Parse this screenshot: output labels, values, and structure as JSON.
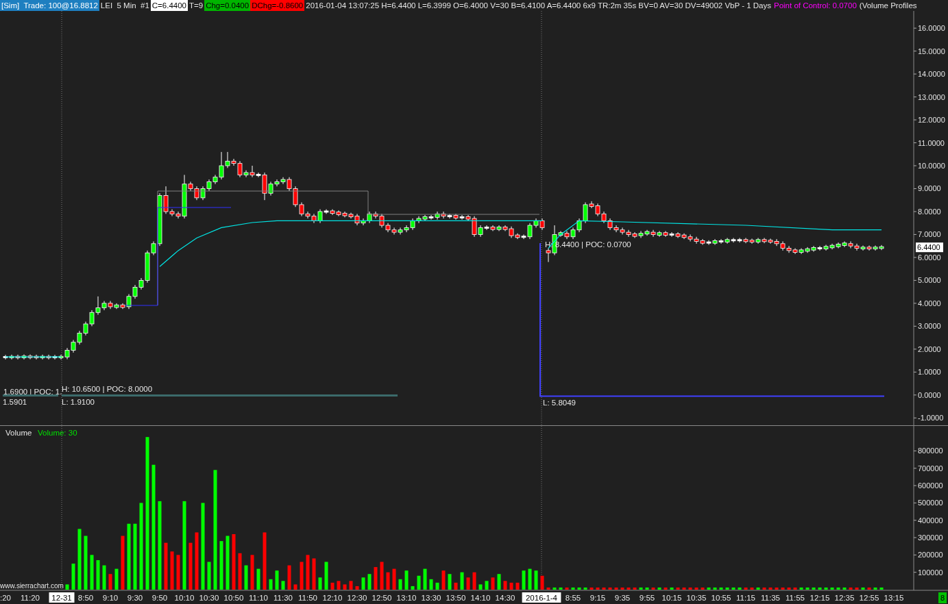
{
  "header": [
    {
      "text": "[Sim]  Trade: 100@16.8812",
      "kind": "sim"
    },
    {
      "text": "LEI  5 Min  #1",
      "kind": "plain"
    },
    {
      "text": "C=6.4400",
      "kind": "last"
    },
    {
      "text": "T=9",
      "kind": "plain"
    },
    {
      "text": "Chg=0.0400",
      "kind": "up"
    },
    {
      "text": "DChg=-0.8600",
      "kind": "down"
    },
    {
      "text": "2016-01-04 13:07:25 H=6.4400 L=6.3999 O=6.4000 V=30 B=6.4100 A=6.4400 6x9 TR:2m 35s BV=0 AV=30 DV=49002 VbP - 1 Days",
      "kind": "plain"
    },
    {
      "text": "Point of Control: 0.0700",
      "kind": "poc"
    },
    {
      "text": "(Volume Profiles",
      "kind": "plain"
    }
  ],
  "price_pane": {
    "labels": [
      "1.6900 | POC: 1.",
      "1.5901",
      "H: 10.6500 | POC: 8.0000",
      "L: 1.9100",
      "H: 8.4400 | POC: 0.0700",
      "L: 5.8049"
    ],
    "last_price": "6.4400",
    "chart_data": {
      "type": "candlestick",
      "ylim": [
        -1.35,
        16.75
      ],
      "categories": [
        null,
        null,
        null,
        null,
        null,
        null,
        null,
        null,
        null,
        null,
        null,
        null,
        null,
        null,
        null,
        null,
        null,
        null,
        null,
        null,
        null,
        null,
        null,
        null,
        null,
        null,
        null,
        null,
        null,
        null,
        null,
        null,
        null,
        null,
        null,
        null,
        null,
        null,
        null,
        null,
        null,
        null,
        null,
        null,
        null,
        null,
        null,
        null,
        null,
        null,
        null,
        null,
        null,
        null,
        null,
        null,
        null,
        null,
        null,
        null,
        null,
        null,
        null,
        null,
        null,
        null,
        null,
        null,
        null,
        null,
        null,
        null,
        null,
        null,
        null,
        null,
        null,
        null,
        null,
        null,
        null,
        null,
        null,
        null,
        null,
        null,
        null,
        null,
        null,
        null,
        null,
        null,
        null,
        null,
        null,
        null,
        null,
        null,
        null,
        null,
        null,
        null,
        null,
        null,
        null,
        null,
        null,
        null,
        null,
        null,
        null,
        null,
        null,
        null,
        null,
        null,
        null,
        null,
        null,
        null,
        null,
        null,
        null,
        null,
        null,
        null,
        null,
        null,
        null,
        null,
        null,
        null,
        null,
        null,
        null,
        null,
        null,
        null,
        null,
        null,
        null,
        null,
        null,
        null,
        null
      ],
      "yticks": [
        {
          "value": 16,
          "label": "16.0000"
        },
        {
          "value": 15,
          "label": "15.0000"
        },
        {
          "value": 14,
          "label": "14.0000"
        },
        {
          "value": 13,
          "label": "13.0000"
        },
        {
          "value": 12,
          "label": "12.0000"
        },
        {
          "value": 11,
          "label": "11.0000"
        },
        {
          "value": 10,
          "label": "10.0000"
        },
        {
          "value": 9,
          "label": "9.0000"
        },
        {
          "value": 8,
          "label": "8.0000"
        },
        {
          "value": 7,
          "label": "7.0000"
        },
        {
          "value": 6,
          "label": "6.0000"
        },
        {
          "value": 5,
          "label": "5.0000"
        },
        {
          "value": 4,
          "label": "4.0000"
        },
        {
          "value": 3,
          "label": "3.0000"
        },
        {
          "value": 2,
          "label": "2.0000"
        },
        {
          "value": 1,
          "label": "1.0000"
        },
        {
          "value": 0,
          "label": "0.0000"
        },
        {
          "value": -1,
          "label": "-1.0000"
        }
      ],
      "ohlc": [
        [
          1.65,
          1.75,
          1.55,
          1.65
        ],
        [
          1.65,
          1.76,
          1.55,
          1.66
        ],
        [
          1.66,
          1.76,
          1.55,
          1.65
        ],
        [
          1.65,
          1.77,
          1.55,
          1.67
        ],
        [
          1.67,
          1.77,
          1.56,
          1.66
        ],
        [
          1.66,
          1.76,
          1.55,
          1.65
        ],
        [
          1.65,
          1.76,
          1.55,
          1.66
        ],
        [
          1.66,
          1.76,
          1.55,
          1.65
        ],
        [
          1.65,
          1.75,
          1.55,
          1.65
        ],
        [
          1.65,
          1.76,
          1.55,
          1.66
        ],
        [
          1.66,
          2.05,
          1.56,
          1.95
        ],
        [
          1.95,
          2.4,
          1.85,
          2.3
        ],
        [
          2.3,
          2.8,
          2.2,
          2.7
        ],
        [
          2.7,
          3.2,
          2.6,
          3.1
        ],
        [
          3.1,
          3.7,
          3.0,
          3.6
        ],
        [
          3.6,
          4.3,
          3.5,
          3.8
        ],
        [
          3.8,
          4.1,
          3.7,
          4.0
        ],
        [
          4.0,
          4.1,
          3.75,
          3.85
        ],
        [
          3.85,
          4.0,
          3.75,
          3.9
        ],
        [
          3.9,
          4.0,
          3.75,
          3.85
        ],
        [
          3.85,
          4.4,
          3.75,
          4.3
        ],
        [
          4.3,
          4.8,
          4.2,
          4.7
        ],
        [
          4.7,
          5.1,
          4.6,
          5.0
        ],
        [
          5.0,
          6.3,
          4.9,
          6.2
        ],
        [
          6.2,
          6.7,
          6.1,
          6.6
        ],
        [
          6.6,
          8.8,
          6.5,
          8.7
        ],
        [
          8.7,
          9.1,
          7.9,
          8.0
        ],
        [
          8.0,
          8.1,
          7.8,
          7.9
        ],
        [
          7.9,
          8.0,
          7.7,
          7.8
        ],
        [
          7.8,
          9.6,
          7.7,
          9.2
        ],
        [
          9.2,
          9.3,
          8.9,
          9.0
        ],
        [
          9.0,
          9.1,
          8.5,
          8.6
        ],
        [
          8.6,
          9.1,
          8.5,
          9.0
        ],
        [
          9.0,
          9.4,
          8.9,
          9.3
        ],
        [
          9.3,
          9.6,
          9.2,
          9.5
        ],
        [
          9.5,
          10.6,
          9.4,
          10.0
        ],
        [
          10.0,
          10.6,
          9.9,
          10.2
        ],
        [
          10.2,
          10.3,
          10.0,
          10.1
        ],
        [
          10.1,
          10.2,
          9.5,
          9.6
        ],
        [
          9.6,
          9.8,
          9.5,
          9.7
        ],
        [
          9.7,
          10.0,
          9.5,
          9.6
        ],
        [
          9.6,
          9.7,
          9.5,
          9.6
        ],
        [
          9.6,
          9.7,
          8.5,
          8.8
        ],
        [
          8.8,
          9.3,
          8.7,
          9.2
        ],
        [
          9.2,
          9.4,
          9.1,
          9.3
        ],
        [
          9.3,
          9.5,
          9.2,
          9.4
        ],
        [
          9.4,
          9.5,
          8.9,
          9.0
        ],
        [
          9.0,
          9.1,
          8.2,
          8.3
        ],
        [
          8.3,
          8.4,
          7.8,
          7.9
        ],
        [
          7.9,
          8.0,
          7.7,
          7.8
        ],
        [
          7.8,
          7.9,
          7.5,
          7.6
        ],
        [
          7.6,
          8.1,
          7.5,
          8.0
        ],
        [
          8.0,
          8.1,
          7.9,
          8.0
        ],
        [
          8.0,
          8.1,
          7.85,
          7.95
        ],
        [
          7.95,
          8.05,
          7.8,
          7.9
        ],
        [
          7.9,
          8.0,
          7.75,
          7.85
        ],
        [
          7.85,
          7.95,
          7.7,
          7.8
        ],
        [
          7.8,
          7.9,
          7.4,
          7.5
        ],
        [
          7.5,
          7.7,
          7.4,
          7.6
        ],
        [
          7.6,
          8.0,
          7.5,
          7.9
        ],
        [
          7.9,
          8.0,
          7.7,
          7.8
        ],
        [
          7.8,
          7.9,
          7.3,
          7.4
        ],
        [
          7.4,
          7.5,
          7.1,
          7.2
        ],
        [
          7.2,
          7.3,
          7.0,
          7.1
        ],
        [
          7.1,
          7.3,
          7.0,
          7.2
        ],
        [
          7.2,
          7.4,
          7.1,
          7.3
        ],
        [
          7.3,
          7.7,
          7.2,
          7.6
        ],
        [
          7.6,
          7.8,
          7.5,
          7.7
        ],
        [
          7.7,
          7.85,
          7.6,
          7.75
        ],
        [
          7.75,
          7.85,
          7.65,
          7.75
        ],
        [
          7.75,
          8.0,
          7.65,
          7.9
        ],
        [
          7.9,
          8.0,
          7.7,
          7.8
        ],
        [
          7.8,
          7.9,
          7.7,
          7.8
        ],
        [
          7.8,
          7.9,
          7.65,
          7.75
        ],
        [
          7.75,
          7.85,
          7.65,
          7.75
        ],
        [
          7.75,
          7.85,
          7.6,
          7.7
        ],
        [
          7.7,
          7.8,
          6.9,
          7.0
        ],
        [
          7.0,
          7.4,
          6.9,
          7.3
        ],
        [
          7.3,
          7.4,
          7.2,
          7.3
        ],
        [
          7.3,
          7.4,
          7.15,
          7.25
        ],
        [
          7.25,
          7.4,
          7.15,
          7.3
        ],
        [
          7.3,
          7.4,
          7.15,
          7.25
        ],
        [
          7.25,
          7.35,
          6.85,
          6.95
        ],
        [
          6.95,
          7.05,
          6.8,
          6.9
        ],
        [
          6.9,
          7.0,
          6.8,
          6.9
        ],
        [
          6.9,
          7.5,
          6.8,
          7.4
        ],
        [
          7.4,
          7.7,
          7.3,
          7.6
        ],
        [
          7.6,
          7.7,
          7.2,
          7.3
        ],
        [
          6.3,
          6.4,
          5.8,
          6.2
        ],
        [
          6.2,
          7.4,
          6.1,
          7.0
        ],
        [
          7.0,
          7.15,
          6.9,
          7.05
        ],
        [
          7.05,
          7.15,
          6.8,
          6.9
        ],
        [
          6.9,
          7.3,
          6.8,
          7.2
        ],
        [
          7.2,
          7.7,
          7.1,
          7.6
        ],
        [
          7.6,
          8.4,
          7.5,
          8.3
        ],
        [
          8.3,
          8.45,
          8.15,
          8.25
        ],
        [
          8.25,
          8.35,
          7.8,
          7.9
        ],
        [
          7.9,
          8.0,
          7.5,
          7.6
        ],
        [
          7.6,
          7.7,
          7.2,
          7.3
        ],
        [
          7.3,
          7.4,
          7.1,
          7.2
        ],
        [
          7.2,
          7.3,
          7.0,
          7.1
        ],
        [
          7.1,
          7.2,
          6.9,
          7.0
        ],
        [
          7.0,
          7.1,
          6.85,
          6.95
        ],
        [
          6.95,
          7.15,
          6.85,
          7.05
        ],
        [
          7.05,
          7.2,
          6.95,
          7.1
        ],
        [
          7.1,
          7.2,
          6.9,
          7.0
        ],
        [
          7.0,
          7.15,
          6.9,
          7.05
        ],
        [
          7.05,
          7.15,
          6.9,
          7.0
        ],
        [
          7.0,
          7.1,
          6.9,
          7.0
        ],
        [
          7.0,
          7.1,
          6.85,
          6.95
        ],
        [
          6.95,
          7.05,
          6.8,
          6.9
        ],
        [
          6.9,
          7.0,
          6.7,
          6.8
        ],
        [
          6.8,
          6.9,
          6.6,
          6.7
        ],
        [
          6.7,
          6.8,
          6.55,
          6.65
        ],
        [
          6.65,
          6.75,
          6.55,
          6.65
        ],
        [
          6.65,
          6.8,
          6.55,
          6.7
        ],
        [
          6.7,
          6.8,
          6.6,
          6.7
        ],
        [
          6.7,
          6.85,
          6.6,
          6.75
        ],
        [
          6.75,
          6.85,
          6.65,
          6.75
        ],
        [
          6.75,
          6.85,
          6.65,
          6.75
        ],
        [
          6.75,
          6.85,
          6.62,
          6.72
        ],
        [
          6.72,
          6.82,
          6.6,
          6.7
        ],
        [
          6.7,
          6.85,
          6.6,
          6.75
        ],
        [
          6.75,
          6.85,
          6.62,
          6.72
        ],
        [
          6.72,
          6.82,
          6.6,
          6.7
        ],
        [
          6.7,
          6.8,
          6.5,
          6.6
        ],
        [
          6.6,
          6.7,
          6.3,
          6.4
        ],
        [
          6.4,
          6.5,
          6.2,
          6.3
        ],
        [
          6.3,
          6.4,
          6.15,
          6.25
        ],
        [
          6.25,
          6.4,
          6.15,
          6.3
        ],
        [
          6.3,
          6.45,
          6.2,
          6.35
        ],
        [
          6.35,
          6.5,
          6.25,
          6.4
        ],
        [
          6.4,
          6.5,
          6.3,
          6.4
        ],
        [
          6.4,
          6.55,
          6.3,
          6.45
        ],
        [
          6.45,
          6.6,
          6.35,
          6.5
        ],
        [
          6.5,
          6.65,
          6.4,
          6.55
        ],
        [
          6.55,
          6.7,
          6.45,
          6.6
        ],
        [
          6.6,
          6.7,
          6.4,
          6.5
        ],
        [
          6.5,
          6.6,
          6.3,
          6.4
        ],
        [
          6.4,
          6.52,
          6.3,
          6.42
        ],
        [
          6.42,
          6.52,
          6.3,
          6.4
        ],
        [
          6.4,
          6.52,
          6.3,
          6.42
        ],
        [
          6.42,
          6.54,
          6.32,
          6.44
        ],
        null,
        null
      ]
    }
  },
  "volume_pane": {
    "reading": "Volume: 30",
    "watermark": "www.sierrachart.com",
    "session_dates": [
      "12-31",
      "2016-1-4"
    ],
    "chart_data": {
      "type": "bar",
      "title": "Volume",
      "ylim": [
        0,
        944000
      ],
      "categories": [
        ":20",
        null,
        null,
        null,
        "11:20",
        null,
        null,
        null,
        null,
        null,
        null,
        null,
        null,
        "8:50",
        null,
        null,
        null,
        "9:10",
        null,
        null,
        null,
        "9:30",
        null,
        null,
        null,
        "9:50",
        null,
        null,
        null,
        "10:10",
        null,
        null,
        null,
        "10:30",
        null,
        null,
        null,
        "10:50",
        null,
        null,
        null,
        "11:10",
        null,
        null,
        null,
        "11:30",
        null,
        null,
        null,
        "11:50",
        null,
        null,
        null,
        "12:10",
        null,
        null,
        null,
        "12:30",
        null,
        null,
        null,
        "12:50",
        null,
        null,
        null,
        "13:10",
        null,
        null,
        null,
        "13:30",
        null,
        null,
        null,
        "13:50",
        null,
        null,
        null,
        "14:10",
        null,
        null,
        null,
        "14:30",
        null,
        null,
        null,
        null,
        null,
        null,
        null,
        null,
        null,
        null,
        "8:55",
        null,
        null,
        null,
        "9:15",
        null,
        null,
        null,
        "9:35",
        null,
        null,
        null,
        "9:55",
        null,
        null,
        null,
        "10:15",
        null,
        null,
        null,
        "10:35",
        null,
        null,
        null,
        "10:55",
        null,
        null,
        null,
        "11:15",
        null,
        null,
        null,
        "11:35",
        null,
        null,
        null,
        "11:55",
        null,
        null,
        null,
        "12:15",
        null,
        null,
        null,
        "12:35",
        null,
        null,
        null,
        "12:55",
        null,
        null,
        null,
        "13:15"
      ],
      "yticks": [
        {
          "value": 800000,
          "label": "800000"
        },
        {
          "value": 700000,
          "label": "700000"
        },
        {
          "value": 600000,
          "label": "600000"
        },
        {
          "value": 500000,
          "label": "500000"
        },
        {
          "value": 400000,
          "label": "400000"
        },
        {
          "value": 300000,
          "label": "300000"
        },
        {
          "value": 200000,
          "label": "200000"
        },
        {
          "value": 100000,
          "label": "100000"
        }
      ],
      "series": [
        {
          "color": "#00ff00",
          "values": [
            null,
            null,
            null,
            null,
            null,
            null,
            null,
            null,
            null,
            null,
            30000,
            150000,
            350000,
            310000,
            200000,
            170000,
            140000,
            null,
            120000,
            null,
            380000,
            380000,
            500000,
            880000,
            720000,
            510000,
            null,
            null,
            null,
            510000,
            null,
            null,
            500000,
            160000,
            690000,
            280000,
            310000,
            null,
            null,
            140000,
            null,
            120000,
            null,
            60000,
            110000,
            50000,
            null,
            null,
            null,
            null,
            null,
            70000,
            160000,
            null,
            null,
            null,
            null,
            null,
            70000,
            90000,
            null,
            null,
            null,
            null,
            60000,
            110000,
            20000,
            80000,
            120000,
            60000,
            40000,
            null,
            90000,
            null,
            100000,
            null,
            null,
            30000,
            50000,
            null,
            90000,
            null,
            null,
            null,
            110000,
            120000,
            110000,
            null,
            null,
            12000,
            12000,
            null,
            12000,
            12000,
            12000,
            null,
            null,
            null,
            null,
            null,
            null,
            null,
            null,
            12000,
            12000,
            null,
            12000,
            null,
            12000,
            null,
            null,
            null,
            null,
            null,
            12000,
            12000,
            12000,
            12000,
            12000,
            12000,
            null,
            null,
            12000,
            null,
            null,
            null,
            null,
            null,
            null,
            12000,
            12000,
            12000,
            12000,
            12000,
            12000,
            12000,
            12000,
            null,
            null,
            12000,
            null,
            12000,
            12000,
            null,
            null
          ]
        },
        {
          "color": "#ff0000",
          "values": [
            null,
            null,
            null,
            null,
            null,
            null,
            null,
            null,
            null,
            null,
            null,
            null,
            null,
            null,
            null,
            null,
            null,
            90000,
            null,
            310000,
            null,
            null,
            null,
            null,
            null,
            null,
            270000,
            220000,
            200000,
            null,
            270000,
            330000,
            null,
            null,
            null,
            null,
            null,
            320000,
            210000,
            null,
            200000,
            null,
            330000,
            null,
            null,
            null,
            140000,
            30000,
            160000,
            200000,
            180000,
            null,
            null,
            40000,
            50000,
            30000,
            50000,
            20000,
            null,
            null,
            130000,
            160000,
            100000,
            120000,
            null,
            null,
            null,
            null,
            null,
            null,
            null,
            110000,
            null,
            40000,
            null,
            70000,
            100000,
            null,
            null,
            70000,
            null,
            50000,
            40000,
            40000,
            null,
            null,
            null,
            80000,
            12000,
            null,
            null,
            12000,
            null,
            null,
            null,
            12000,
            12000,
            12000,
            12000,
            12000,
            12000,
            12000,
            12000,
            null,
            null,
            12000,
            null,
            12000,
            null,
            12000,
            12000,
            12000,
            12000,
            12000,
            null,
            null,
            null,
            null,
            null,
            null,
            12000,
            12000,
            null,
            12000,
            12000,
            12000,
            12000,
            12000,
            12000,
            null,
            null,
            null,
            null,
            null,
            null,
            null,
            null,
            12000,
            12000,
            null,
            12000,
            null,
            null,
            null,
            null
          ]
        }
      ]
    }
  },
  "status_badge": "8"
}
